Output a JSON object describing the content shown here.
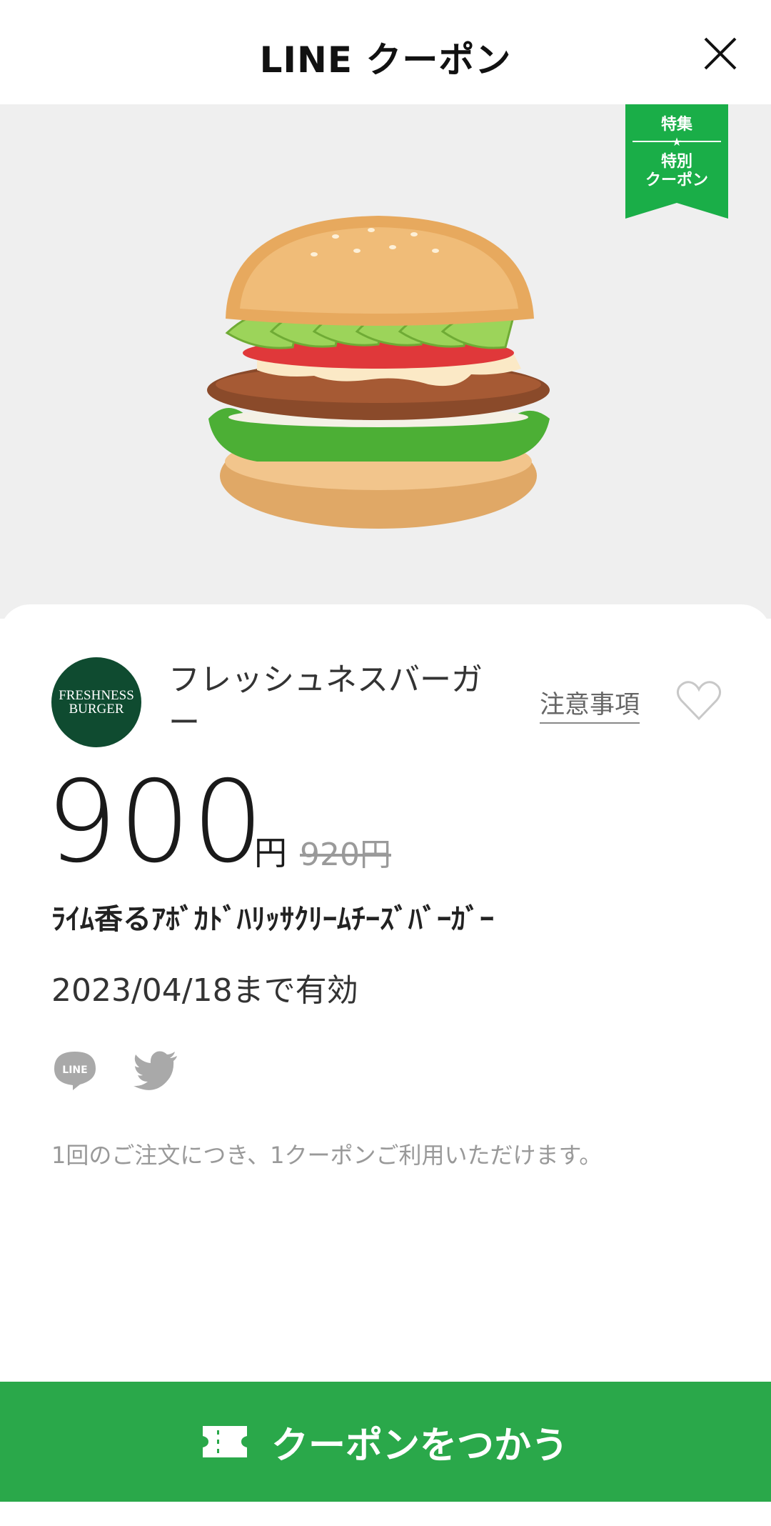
{
  "header": {
    "title": "LINE クーポン"
  },
  "badge": {
    "line1": "特集",
    "star": "★",
    "line2": "特別",
    "line3": "クーポン"
  },
  "store": {
    "logo_line1": "FRESHNESS",
    "logo_line2": "BURGER",
    "name": "フレッシュネスバーガー",
    "notice_link": "注意事項"
  },
  "coupon": {
    "price": "900",
    "yen": "円",
    "original_price": "920円",
    "product_name": "ﾗｲﾑ香るｱﾎﾞｶﾄﾞﾊﾘｯｻｸﾘｰﾑﾁｰｽﾞﾊﾞｰｶﾞｰ",
    "valid_until": "2023/04/18まで有効",
    "usage_note": "1回のご注文につき、1クーポンご利用いただけます。"
  },
  "share": {
    "line_label": "LINE"
  },
  "cta": {
    "label": "クーポンをつかう"
  },
  "colors": {
    "brand_green": "#2aa84a",
    "logo_green": "#0f4b30",
    "badge_green": "#1aae48"
  },
  "icons": [
    "close-icon",
    "heart-icon",
    "line-share-icon",
    "twitter-icon",
    "ticket-icon"
  ]
}
